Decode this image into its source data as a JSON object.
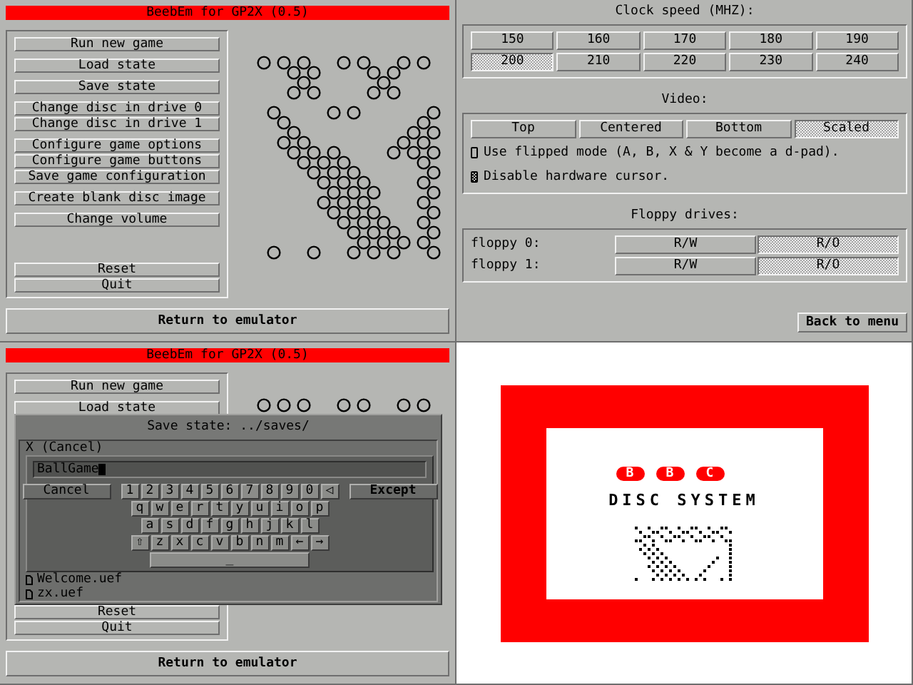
{
  "menu_screen": {
    "title": "BeebEm for GP2X (0.5)",
    "button_groups": [
      [
        "Run new game"
      ],
      [
        "Load state"
      ],
      [
        "Save state"
      ],
      [
        "Change disc in drive 0",
        "Change disc in drive 1"
      ],
      [
        "Configure game options",
        "Configure game buttons",
        "Save game configuration"
      ],
      [
        "Create blank disc image"
      ],
      [
        "Change volume"
      ],
      [
        "Reset",
        "Quit"
      ]
    ],
    "return_button": "Return to emulator"
  },
  "options_screen": {
    "clock_heading": "Clock speed (MHZ):",
    "clock_speeds": [
      {
        "label": "150",
        "selected": false
      },
      {
        "label": "160",
        "selected": false
      },
      {
        "label": "170",
        "selected": false
      },
      {
        "label": "180",
        "selected": false
      },
      {
        "label": "190",
        "selected": false
      },
      {
        "label": "200",
        "selected": true
      },
      {
        "label": "210",
        "selected": false
      },
      {
        "label": "220",
        "selected": false
      },
      {
        "label": "230",
        "selected": false
      },
      {
        "label": "240",
        "selected": false
      }
    ],
    "video_heading": "Video:",
    "video_modes": [
      {
        "label": "Top",
        "selected": false
      },
      {
        "label": "Centered",
        "selected": false
      },
      {
        "label": "Bottom",
        "selected": false
      },
      {
        "label": "Scaled",
        "selected": true
      }
    ],
    "checkboxes": [
      {
        "label": "Use flipped mode (A, B, X & Y become a d-pad).",
        "checked": false
      },
      {
        "label": "Disable hardware cursor.",
        "checked": true
      }
    ],
    "floppy_heading": "Floppy drives:",
    "floppy_drives": [
      {
        "label": "floppy 0:",
        "modes": [
          {
            "label": "R/W",
            "selected": false
          },
          {
            "label": "R/O",
            "selected": true
          }
        ]
      },
      {
        "label": "floppy 1:",
        "modes": [
          {
            "label": "R/W",
            "selected": false
          },
          {
            "label": "R/O",
            "selected": true
          }
        ]
      }
    ],
    "back_button": "Back to menu"
  },
  "save_screen": {
    "title": "BeebEm for GP2X (0.5)",
    "button_groups": [
      [
        "Run new game"
      ],
      [
        "Load state"
      ],
      [
        "Reset",
        "Quit"
      ]
    ],
    "return_button": "Return to emulator",
    "dialog": {
      "title": "Save state: ../saves/",
      "entries": [
        {
          "label": "X (Cancel)",
          "kind": "action"
        },
        {
          "label": "Welcome.uef",
          "kind": "file"
        },
        {
          "label": "zx.uef",
          "kind": "file"
        }
      ],
      "input": {
        "value": "BallGame"
      },
      "cancel_key": "Cancel",
      "accept_key": "Except",
      "key_rows": [
        [
          "1",
          "2",
          "3",
          "4",
          "5",
          "6",
          "7",
          "8",
          "9",
          "0",
          "◁"
        ],
        [
          "q",
          "w",
          "e",
          "r",
          "t",
          "y",
          "u",
          "i",
          "o",
          "p"
        ],
        [
          "a",
          "s",
          "d",
          "f",
          "g",
          "h",
          "j",
          "k",
          "l"
        ],
        [
          "⇧",
          "z",
          "x",
          "c",
          "v",
          "b",
          "n",
          "m",
          "←",
          "→"
        ]
      ],
      "space_key": "_"
    }
  },
  "boot_screen": {
    "logo_letters": [
      "B",
      "B",
      "C"
    ],
    "title": "DISC SYSTEM"
  }
}
